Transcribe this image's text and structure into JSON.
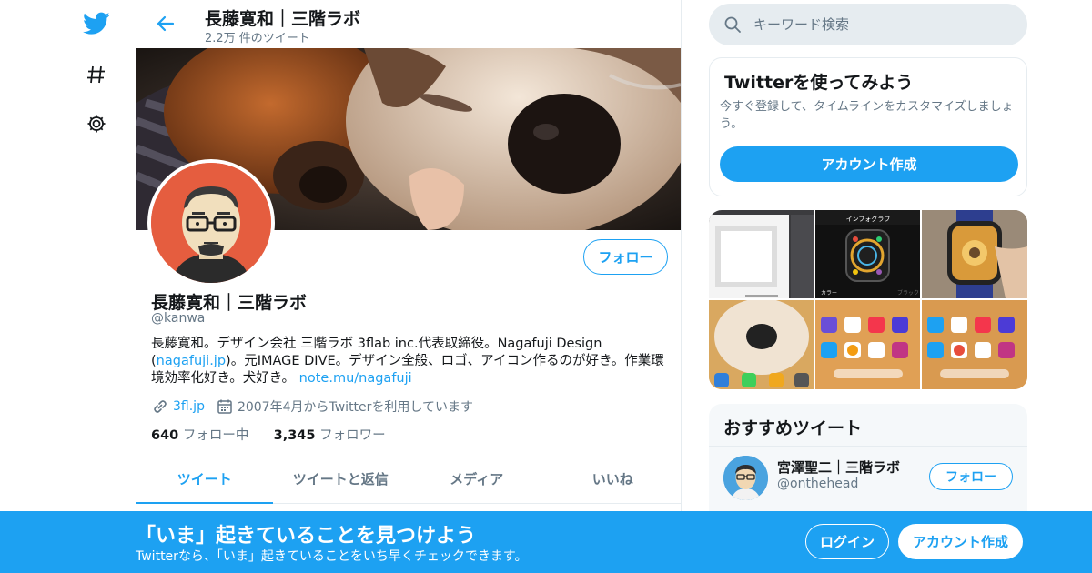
{
  "nav": {
    "icons": [
      "twitter-bird-icon",
      "hashtag-icon",
      "gear-icon"
    ]
  },
  "header": {
    "name": "長藤寛和｜三階ラボ",
    "tweet_count": "2.2万 件のツイート"
  },
  "profile": {
    "follow_label": "フォロー",
    "name": "長藤寛和｜三階ラボ",
    "handle": "@kanwa",
    "bio": {
      "part1": "長藤寛和。デザイン会社 三階ラボ 3flab inc.代表取締役。Nagafuji Design (",
      "link1": "nagafuji.jp",
      "part2": ")。元IMAGE DIVE。デザイン全般、ロゴ、アイコン作るのが好き。作業環境効率化好き。犬好き。 ",
      "link2": "note.mu/nagafuji"
    },
    "website": "3fl.jp",
    "joined": "2007年4月からTwitterを利用しています",
    "following_count": "640",
    "following_label": "フォロー中",
    "followers_count": "3,345",
    "followers_label": "フォロワー"
  },
  "tabs": [
    "ツイート",
    "ツイートと返信",
    "メディア",
    "いいね"
  ],
  "active_tab": 0,
  "search": {
    "placeholder": "キーワード検索"
  },
  "try_card": {
    "title": "Twitterを使ってみよう",
    "description": "今すぐ登録して、タイムラインをカスタマイズしましょう。",
    "button": "アカウント作成"
  },
  "media_thumbs": {
    "screen_title": "インフォグラフ",
    "screen_caption": "カラー",
    "screen_caption2": "ブラック"
  },
  "recommended": {
    "title": "おすすめツイート",
    "users": [
      {
        "name": "宮澤聖二｜三階ラボ",
        "handle": "@onthehead",
        "follow_label": "フォロー"
      }
    ]
  },
  "bottom_bar": {
    "headline": "「いま」起きていることを見つけよう",
    "subtext": "Twitterなら、「いま」起きていることをいち早くチェックできます。",
    "login": "ログイン",
    "signup": "アカウント作成"
  },
  "colors": {
    "accent": "#1da1f2",
    "text": "#14171a",
    "secondary_text": "#657786",
    "avatar_bg": "#e55d3f"
  }
}
